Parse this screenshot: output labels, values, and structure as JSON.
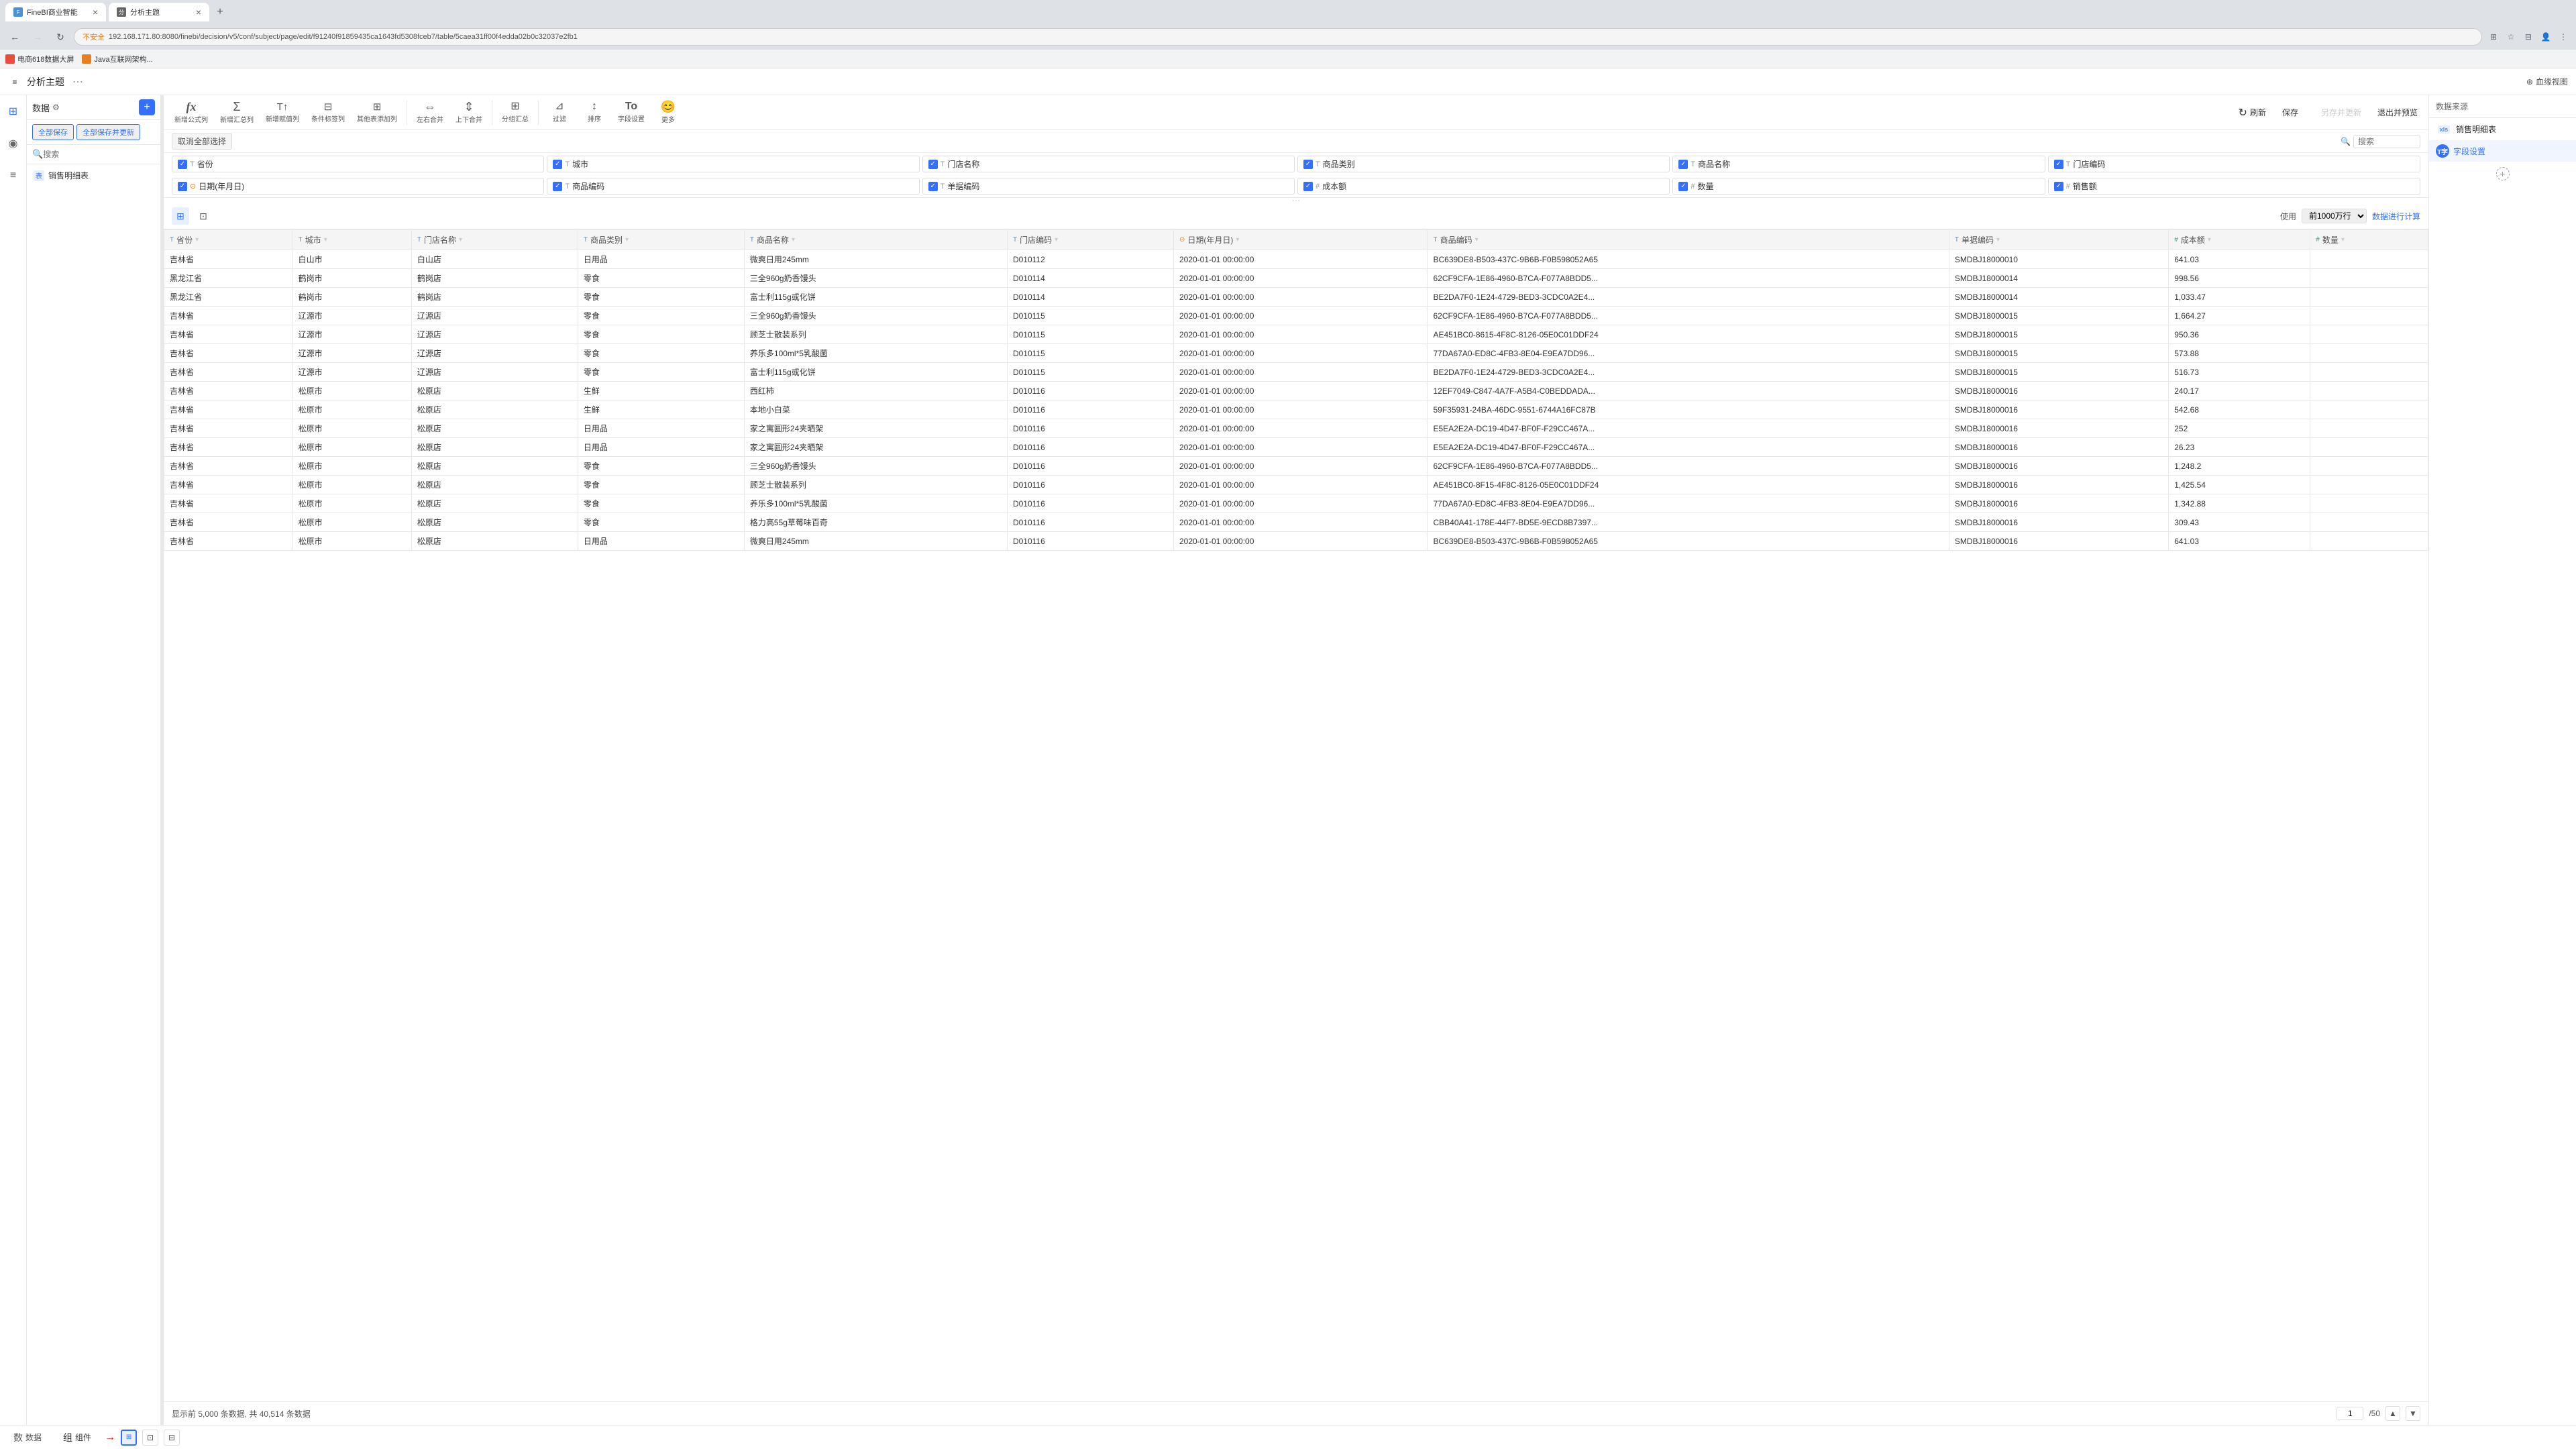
{
  "browser": {
    "tabs": [
      {
        "id": "tab1",
        "favicon": "F",
        "title": "FineBI商业智能",
        "active": false
      },
      {
        "id": "tab2",
        "favicon": "分",
        "title": "分析主题",
        "active": true
      }
    ],
    "new_tab_label": "+",
    "address": "192.168.171.80:8080/finebi/decision/v5/conf/subject/page/edit/f91240f91859435ca1643fd5308fceb7/table/5caea31ff00f4edda02b0c32037e2fb1",
    "address_protocol": "不安全",
    "bookmarks": [
      {
        "label": "电商618数据大屏"
      },
      {
        "label": "Java互联网架构..."
      }
    ]
  },
  "app": {
    "title": "分析主题",
    "more_icon": "•••"
  },
  "sidebar": {
    "icons": [
      "⊞",
      "◉",
      "≡"
    ]
  },
  "data_panel": {
    "title": "数据",
    "settings_icon": "⚙",
    "add_icon": "+",
    "save_all_label": "全部保存",
    "save_update_label": "全部保存并更新",
    "search_placeholder": "搜索",
    "tables": [
      {
        "icon": "表",
        "name": "销售明细表"
      }
    ]
  },
  "toolbar": {
    "buttons": [
      {
        "icon": "fx",
        "label": "新增公式列"
      },
      {
        "icon": "Σ",
        "label": "新增汇总列"
      },
      {
        "icon": "T↕",
        "label": "新增赋值列"
      },
      {
        "icon": "⊟",
        "label": "条件标签列"
      },
      {
        "icon": "⊞",
        "label": "其他表添加列"
      },
      {
        "icon": "⇔",
        "label": "左右合并"
      },
      {
        "icon": "⇕",
        "label": "上下合并"
      },
      {
        "icon": "⊞",
        "label": "分组汇总"
      },
      {
        "icon": "⊿",
        "label": "过滤"
      },
      {
        "icon": "↕",
        "label": "排序"
      },
      {
        "icon": "To",
        "label": "字段设置"
      },
      {
        "icon": "☺",
        "label": "更多"
      }
    ],
    "right_buttons": [
      {
        "label": "刷新",
        "icon": "↻",
        "type": "normal"
      },
      {
        "label": "保存",
        "icon": "",
        "type": "normal"
      },
      {
        "label": "另存并更新",
        "icon": "",
        "type": "disabled"
      },
      {
        "label": "退出并预览",
        "icon": "",
        "type": "normal"
      }
    ]
  },
  "field_area": {
    "deselect_label": "取消全部选择",
    "search_placeholder": "搜索",
    "fields": [
      {
        "name": "省份",
        "type": "T",
        "checked": true
      },
      {
        "name": "城市",
        "type": "T",
        "checked": true
      },
      {
        "name": "门店名称",
        "type": "T",
        "checked": true
      },
      {
        "name": "商品类别",
        "type": "T",
        "checked": true
      },
      {
        "name": "商品名称",
        "type": "T",
        "checked": true
      },
      {
        "name": "门店编码",
        "type": "T",
        "checked": true
      },
      {
        "name": "日期(年月日)",
        "type": "date",
        "checked": true
      },
      {
        "name": "商品编码",
        "type": "T",
        "checked": true
      },
      {
        "name": "单据编码",
        "type": "T",
        "checked": true
      },
      {
        "name": "成本额",
        "type": "hash",
        "checked": true
      },
      {
        "name": "数量",
        "type": "hash",
        "checked": true
      },
      {
        "name": "销售额",
        "type": "hash",
        "checked": true
      }
    ]
  },
  "table": {
    "view_options": [
      "grid",
      "list"
    ],
    "use_label": "使用",
    "rows_option": "前1000万行",
    "calc_label": "数据进行计算",
    "columns": [
      {
        "name": "省份",
        "type": "T"
      },
      {
        "name": "城市",
        "type": "T"
      },
      {
        "name": "门店名称",
        "type": "T"
      },
      {
        "name": "商品类别",
        "type": "T"
      },
      {
        "name": "商品名称",
        "type": "T"
      },
      {
        "name": "门店编码",
        "type": "T"
      },
      {
        "name": "日期(年月日)",
        "type": "date"
      },
      {
        "name": "商品编码",
        "type": "T"
      },
      {
        "name": "单据编码",
        "type": "T"
      },
      {
        "name": "成本额",
        "type": "hash"
      },
      {
        "name": "数量",
        "type": "hash"
      }
    ],
    "rows": [
      [
        "吉林省",
        "白山市",
        "白山店",
        "日用品",
        "微爽日用245mm",
        "D010112",
        "2020-01-01 00:00:00",
        "BC639DE8-B503-437C-9B6B-F0B598052A65",
        "SMDBJ18000010",
        "641.03",
        ""
      ],
      [
        "黑龙江省",
        "鹤岗市",
        "鹤岗店",
        "零食",
        "三全960g奶香馒头",
        "D010114",
        "2020-01-01 00:00:00",
        "62CF9CFA-1E86-4960-B7CA-F077A8BDD5...",
        "SMDBJ18000014",
        "998.56",
        ""
      ],
      [
        "黑龙江省",
        "鹤岗市",
        "鹤岗店",
        "零食",
        "富士利115g或化饼",
        "D010114",
        "2020-01-01 00:00:00",
        "BE2DA7F0-1E24-4729-BED3-3CDC0A2E4...",
        "SMDBJ18000014",
        "1,033.47",
        ""
      ],
      [
        "吉林省",
        "辽源市",
        "辽源店",
        "零食",
        "三全960g奶香馒头",
        "D010115",
        "2020-01-01 00:00:00",
        "62CF9CFA-1E86-4960-B7CA-F077A8BDD5...",
        "SMDBJ18000015",
        "1,664.27",
        ""
      ],
      [
        "吉林省",
        "辽源市",
        "辽源店",
        "零食",
        "顾芝士散装系列",
        "D010115",
        "2020-01-01 00:00:00",
        "AE451BC0-8615-4F8C-8126-05E0C01DDF24",
        "SMDBJ18000015",
        "950.36",
        ""
      ],
      [
        "吉林省",
        "辽源市",
        "辽源店",
        "零食",
        "养乐多100ml*5乳酸菌",
        "D010115",
        "2020-01-01 00:00:00",
        "77DA67A0-ED8C-4FB3-8E04-E9EA7DD96...",
        "SMDBJ18000015",
        "573.88",
        ""
      ],
      [
        "吉林省",
        "辽源市",
        "辽源店",
        "零食",
        "富士利115g或化饼",
        "D010115",
        "2020-01-01 00:00:00",
        "BE2DA7F0-1E24-4729-BED3-3CDC0A2E4...",
        "SMDBJ18000015",
        "516.73",
        ""
      ],
      [
        "吉林省",
        "松原市",
        "松原店",
        "生鲜",
        "西红柿",
        "D010116",
        "2020-01-01 00:00:00",
        "12EF7049-C847-4A7F-A5B4-C0BEDDADA...",
        "SMDBJ18000016",
        "240.17",
        ""
      ],
      [
        "吉林省",
        "松原市",
        "松原店",
        "生鲜",
        "本地小白菜",
        "D010116",
        "2020-01-01 00:00:00",
        "59F35931-24BA-46DC-9551-6744A16FC87B",
        "SMDBJ18000016",
        "542.68",
        ""
      ],
      [
        "吉林省",
        "松原市",
        "松原店",
        "日用品",
        "家之寓圆形24夹晒架",
        "D010116",
        "2020-01-01 00:00:00",
        "E5EA2E2A-DC19-4D47-BF0F-F29CC467A...",
        "SMDBJ18000016",
        "252",
        ""
      ],
      [
        "吉林省",
        "松原市",
        "松原店",
        "日用品",
        "家之寓圆形24夹晒架",
        "D010116",
        "2020-01-01 00:00:00",
        "E5EA2E2A-DC19-4D47-BF0F-F29CC467A...",
        "SMDBJ18000016",
        "26.23",
        ""
      ],
      [
        "吉林省",
        "松原市",
        "松原店",
        "零食",
        "三全960g奶香馒头",
        "D010116",
        "2020-01-01 00:00:00",
        "62CF9CFA-1E86-4960-B7CA-F077A8BDD5...",
        "SMDBJ18000016",
        "1,248.2",
        ""
      ],
      [
        "吉林省",
        "松原市",
        "松原店",
        "零食",
        "顾芝士散装系列",
        "D010116",
        "2020-01-01 00:00:00",
        "AE451BC0-8F15-4F8C-8126-05E0C01DDF24",
        "SMDBJ18000016",
        "1,425.54",
        ""
      ],
      [
        "吉林省",
        "松原市",
        "松原店",
        "零食",
        "养乐多100ml*5乳酸菌",
        "D010116",
        "2020-01-01 00:00:00",
        "77DA67A0-ED8C-4FB3-8E04-E9EA7DD96...",
        "SMDBJ18000016",
        "1,342.88",
        ""
      ],
      [
        "吉林省",
        "松原市",
        "松原店",
        "零食",
        "格力高55g草莓味百奇",
        "D010116",
        "2020-01-01 00:00:00",
        "CBB40A41-178E-44F7-BD5E-9ECD8B7397...",
        "SMDBJ18000016",
        "309.43",
        ""
      ],
      [
        "吉林省",
        "松原市",
        "松原店",
        "日用品",
        "微爽日用245mm",
        "D010116",
        "2020-01-01 00:00:00",
        "BC639DE8-B503-437C-9B6B-F0B598052A65",
        "SMDBJ18000016",
        "641.03",
        ""
      ]
    ],
    "footer": {
      "display_text": "显示前 5,000 条数据, 共 40,514 条数据",
      "page_current": "1",
      "page_total": "/50"
    }
  },
  "right_panel": {
    "data_source_label": "数据来源",
    "xs_label": "xls",
    "sales_detail_label": "销售明细表",
    "field_settings_label": "字段设置",
    "add_icon": "+"
  },
  "bottom_bar": {
    "tabs": [
      {
        "icon": "数",
        "label": "数据"
      },
      {
        "icon": "组",
        "label": "组件"
      }
    ],
    "view_buttons": [
      "⊞",
      "⊡",
      "⊟"
    ]
  }
}
